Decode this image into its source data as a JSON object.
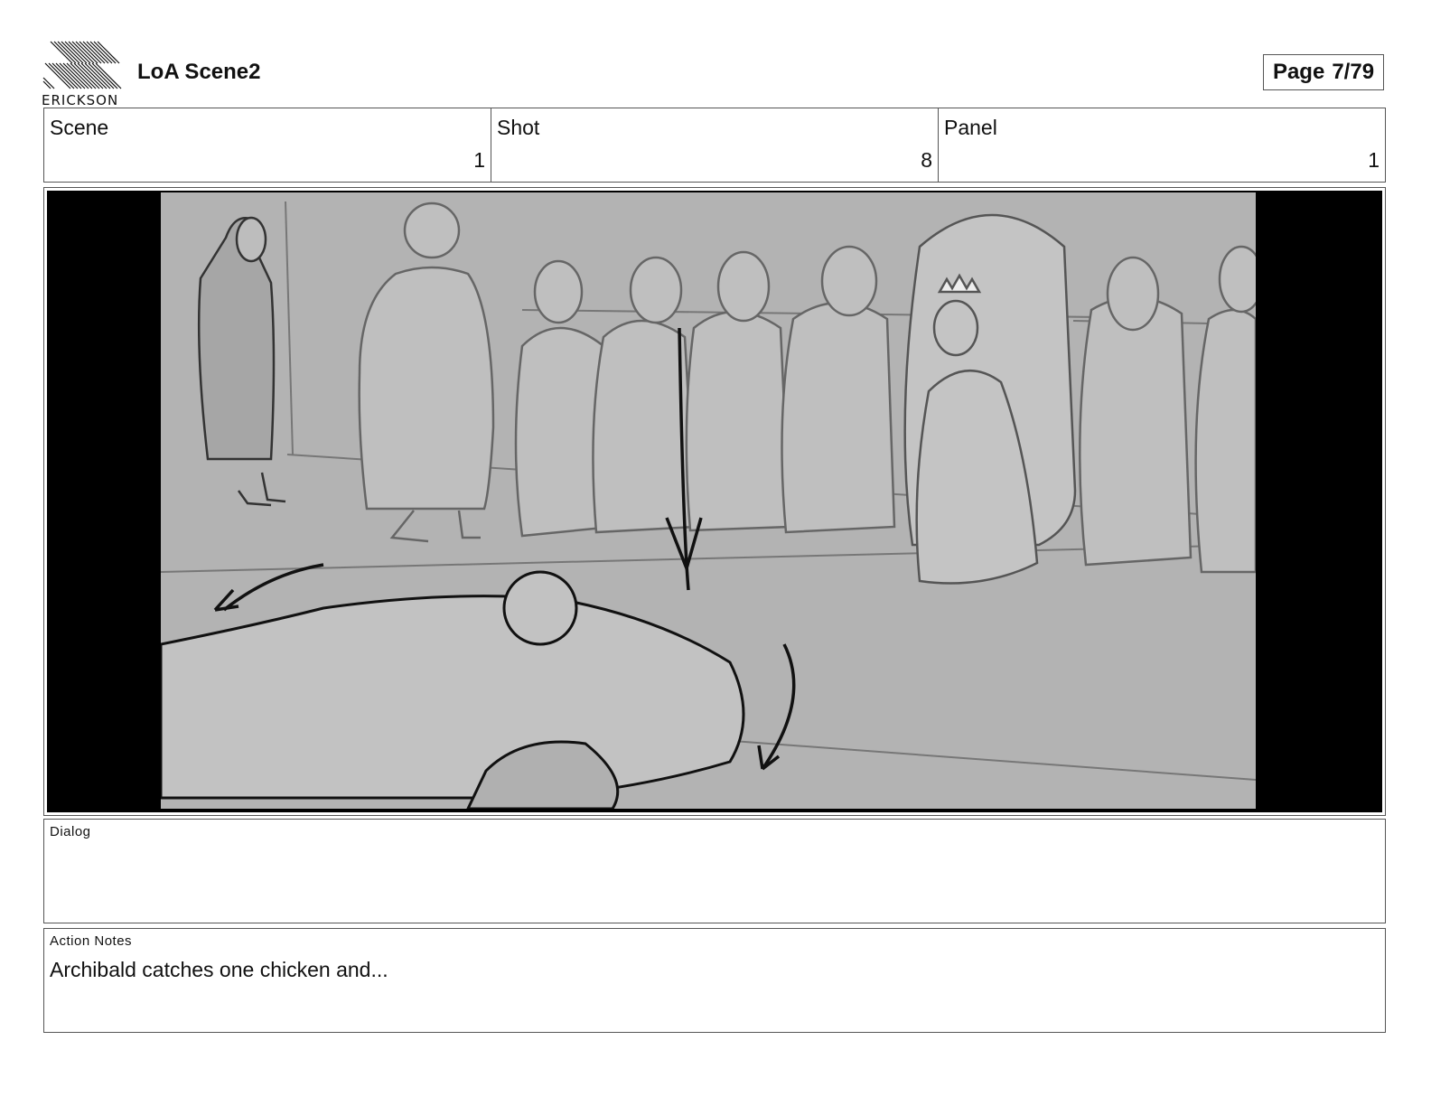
{
  "header": {
    "logo_caption": "ERICKSON",
    "title": "LoA Scene2",
    "page_label": "Page",
    "page_value": "7/79"
  },
  "info": {
    "scene": {
      "label": "Scene",
      "value": "1"
    },
    "shot": {
      "label": "Shot",
      "value": "8"
    },
    "panel": {
      "label": "Panel",
      "value": "1"
    }
  },
  "dialog": {
    "label": "Dialog",
    "text": ""
  },
  "action_notes": {
    "label": "Action Notes",
    "text": "Archibald catches one chicken and..."
  },
  "colors": {
    "frame_bg": "#000000",
    "sketch_bg": "#b3b3b3",
    "border": "#555555"
  }
}
